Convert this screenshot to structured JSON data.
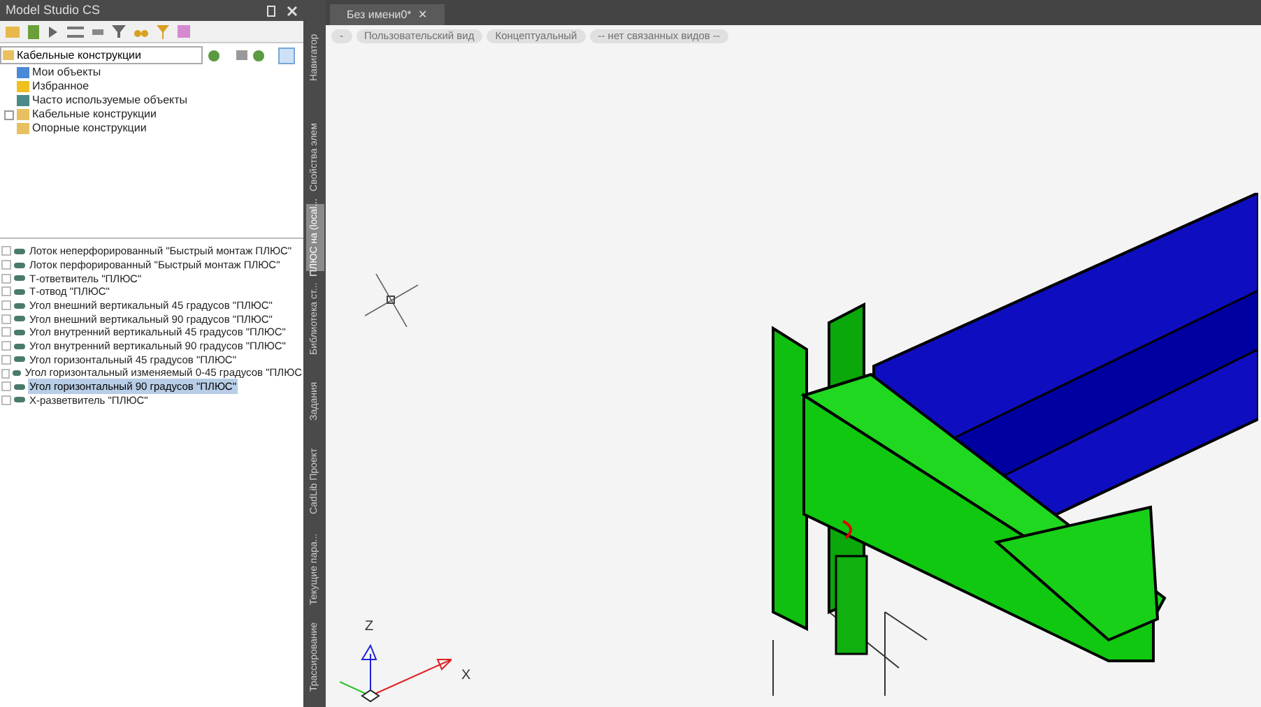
{
  "panel": {
    "title": "Model Studio CS",
    "search": {
      "value": "Кабельные конструкции"
    }
  },
  "tree": [
    {
      "label": "Мои объекты",
      "expandable": false
    },
    {
      "label": "Избранное",
      "expandable": false
    },
    {
      "label": "Часто используемые объекты",
      "expandable": false
    },
    {
      "label": "Кабельные конструкции",
      "expandable": true
    },
    {
      "label": "Опорные конструкции",
      "expandable": false
    }
  ],
  "items": [
    {
      "label": "Лоток неперфорированный \"Быстрый монтаж ПЛЮС\"",
      "selected": false
    },
    {
      "label": "Лоток перфорированный \"Быстрый монтаж ПЛЮС\"",
      "selected": false
    },
    {
      "label": "Т-ответвитель \"ПЛЮС\"",
      "selected": false
    },
    {
      "label": "Т-отвод \"ПЛЮС\"",
      "selected": false
    },
    {
      "label": "Угол внешний вертикальный 45 градусов \"ПЛЮС\"",
      "selected": false
    },
    {
      "label": "Угол внешний вертикальный 90 градусов \"ПЛЮС\"",
      "selected": false
    },
    {
      "label": "Угол внутренний вертикальный 45 градусов \"ПЛЮС\"",
      "selected": false
    },
    {
      "label": "Угол внутренний вертикальный 90 градусов \"ПЛЮС\"",
      "selected": false
    },
    {
      "label": "Угол горизонтальный 45 градусов \"ПЛЮС\"",
      "selected": false
    },
    {
      "label": "Угол горизонтальный изменяемый 0-45 градусов \"ПЛЮС",
      "selected": false
    },
    {
      "label": "Угол горизонтальный 90 градусов \"ПЛЮС\"",
      "selected": true
    },
    {
      "label": "Х-разветвитель \"ПЛЮС\"",
      "selected": false
    }
  ],
  "side_tabs": [
    {
      "label": "Навигатор",
      "selected": false
    },
    {
      "label": "Свойства элем",
      "selected": false
    },
    {
      "label": "ПЛЮС на (local...",
      "selected": true
    },
    {
      "label": "Библиотека ст...",
      "selected": false
    },
    {
      "label": "Задания",
      "selected": false
    },
    {
      "label": "CadLib Проект",
      "selected": false
    },
    {
      "label": "Текущие пара...",
      "selected": false
    },
    {
      "label": "Трассирование",
      "selected": false
    }
  ],
  "document_tab": {
    "title": "Без имени0*",
    "close": "✕"
  },
  "view_controls": [
    "-",
    "Пользовательский вид",
    "Концептуальный",
    "-- нет связанных видов --"
  ],
  "axes": {
    "z": "Z",
    "x": "X"
  }
}
